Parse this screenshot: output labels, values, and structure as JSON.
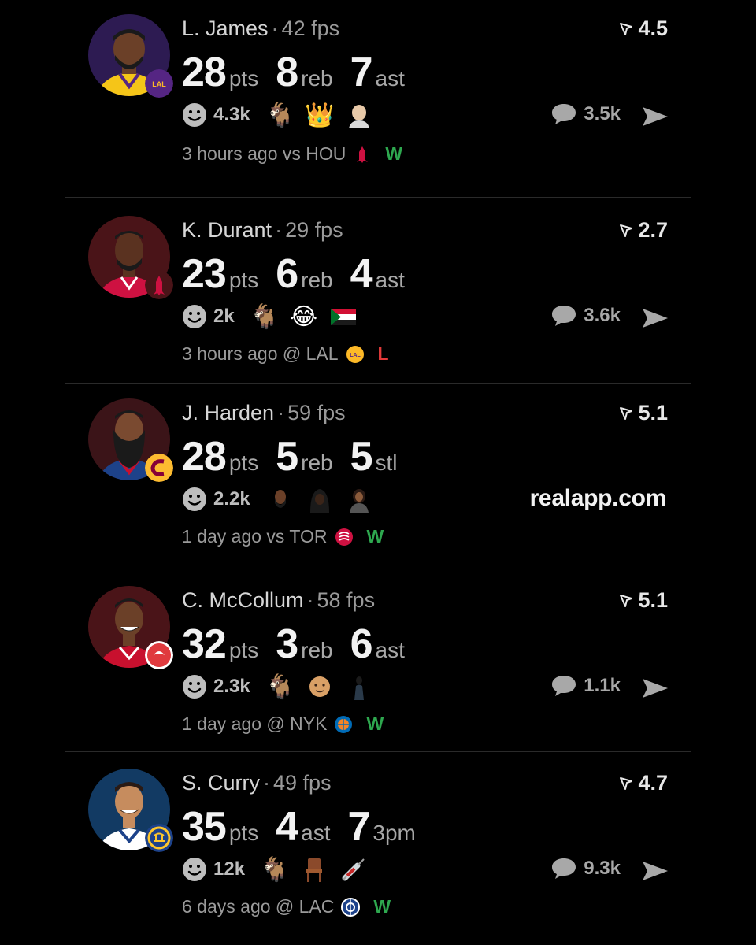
{
  "cards": [
    {
      "player": "L. James",
      "fps": "42 fps",
      "rating": "4.5",
      "stats": [
        {
          "value": "28",
          "label": "pts"
        },
        {
          "value": "8",
          "label": "reb"
        },
        {
          "value": "7",
          "label": "ast"
        }
      ],
      "reaction_count": "4.3k",
      "emojis": [
        "goat",
        "crown",
        "bald-head"
      ],
      "comments": "3.5k",
      "time": "3 hours ago vs HOU",
      "result": "W",
      "colors": {
        "avatar_bg": "#2d1b52",
        "jersey": "#f5c518",
        "team": "#552583"
      }
    },
    {
      "player": "K. Durant",
      "fps": "29 fps",
      "rating": "2.7",
      "stats": [
        {
          "value": "23",
          "label": "pts"
        },
        {
          "value": "6",
          "label": "reb"
        },
        {
          "value": "4",
          "label": "ast"
        }
      ],
      "reaction_count": "2k",
      "emojis": [
        "goat",
        "laughing-tears",
        "flag-sudan"
      ],
      "comments": "3.6k",
      "time": "3 hours ago @ LAL",
      "result": "L",
      "colors": {
        "avatar_bg": "#4a1418",
        "jersey": "#ce1141",
        "team": "#ce1141"
      }
    },
    {
      "player": "J. Harden",
      "fps": "59 fps",
      "rating": "5.1",
      "stats": [
        {
          "value": "28",
          "label": "pts"
        },
        {
          "value": "5",
          "label": "reb"
        },
        {
          "value": "5",
          "label": "stl"
        }
      ],
      "reaction_count": "2.2k",
      "emojis": [
        "face-1",
        "face-2",
        "face-3"
      ],
      "watermark": "realapp.com",
      "time": "1 day ago vs TOR",
      "result": "W",
      "colors": {
        "avatar_bg": "#3b1418",
        "jersey": "#1d428a",
        "team": "#860038"
      }
    },
    {
      "player": "C. McCollum",
      "fps": "58 fps",
      "rating": "5.1",
      "stats": [
        {
          "value": "32",
          "label": "pts"
        },
        {
          "value": "3",
          "label": "reb"
        },
        {
          "value": "6",
          "label": "ast"
        }
      ],
      "reaction_count": "2.3k",
      "emojis": [
        "goat",
        "face-elder",
        "figure"
      ],
      "comments": "1.1k",
      "time": "1 day ago @ NYK",
      "result": "W",
      "colors": {
        "avatar_bg": "#4a1418",
        "jersey": "#c8102e",
        "team": "#e03a3e"
      }
    },
    {
      "player": "S. Curry",
      "fps": "49 fps",
      "rating": "4.7",
      "stats": [
        {
          "value": "35",
          "label": "pts"
        },
        {
          "value": "4",
          "label": "ast"
        },
        {
          "value": "7",
          "label": "3pm"
        }
      ],
      "reaction_count": "12k",
      "emojis": [
        "goat",
        "chair",
        "syringe"
      ],
      "comments": "9.3k",
      "time": "6 days ago @ LAC",
      "result": "W",
      "colors": {
        "avatar_bg": "#123a63",
        "jersey": "#ffffff",
        "team": "#1d428a"
      }
    }
  ]
}
